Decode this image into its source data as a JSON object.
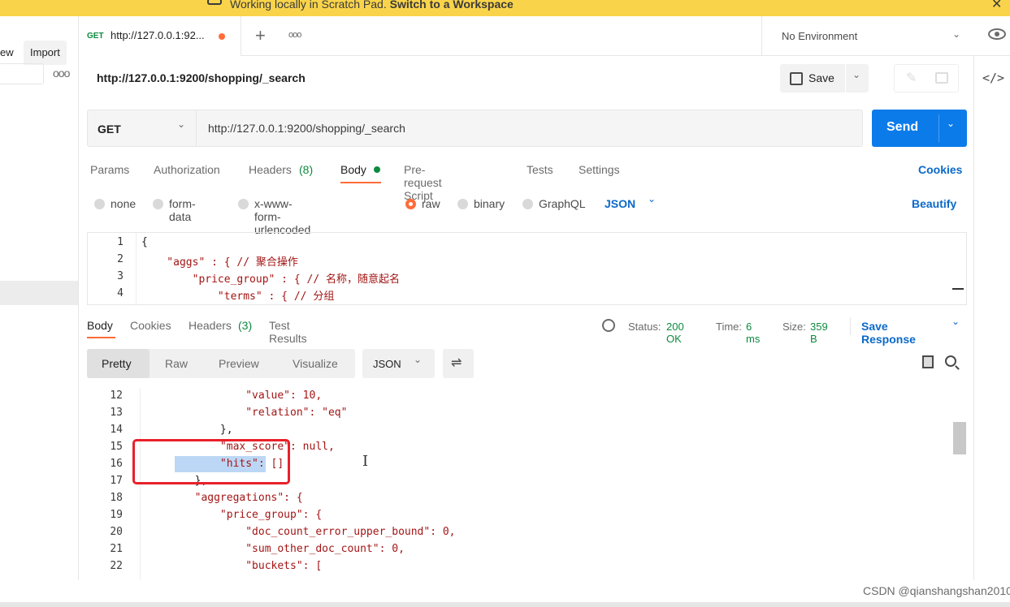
{
  "banner": {
    "prefix": "Working locally in Scratch Pad.",
    "link": "Switch to a Workspace"
  },
  "sidebar": {
    "new_label": "ew",
    "import_label": "Import"
  },
  "tab": {
    "method": "GET",
    "title": "http://127.0.0.1:92..."
  },
  "environment": {
    "label": "No Environment"
  },
  "request": {
    "title": "http://127.0.0.1:9200/shopping/_search",
    "method": "GET",
    "url": "http://127.0.0.1:9200/shopping/_search",
    "save_label": "Save",
    "send_label": "Send"
  },
  "req_tabs": {
    "params": "Params",
    "authorization": "Authorization",
    "headers": "Headers",
    "headers_count": "(8)",
    "body": "Body",
    "prerequest": "Pre-request Script",
    "tests": "Tests",
    "settings": "Settings",
    "cookies": "Cookies"
  },
  "body_types": {
    "none": "none",
    "form_data": "form-data",
    "urlencoded": "x-www-form-urlencoded",
    "raw": "raw",
    "binary": "binary",
    "graphql": "GraphQL",
    "json": "JSON",
    "beautify": "Beautify"
  },
  "editor_lines": [
    {
      "num": "1",
      "text": "{"
    },
    {
      "num": "2",
      "text": "    \"aggs\" : { // 聚合操作"
    },
    {
      "num": "3",
      "text": "        \"price_group\" : { // 名称，随意起名"
    },
    {
      "num": "4",
      "text": "            \"terms\" : { // 分组"
    }
  ],
  "resp_tabs": {
    "body": "Body",
    "cookies": "Cookies",
    "headers": "Headers",
    "headers_count": "(3)",
    "test_results": "Test Results"
  },
  "status": {
    "status_label": "Status:",
    "status_value": "200 OK",
    "time_label": "Time:",
    "time_value": "6 ms",
    "size_label": "Size:",
    "size_value": "359 B",
    "save_response": "Save Response"
  },
  "view_tabs": {
    "pretty": "Pretty",
    "raw": "Raw",
    "preview": "Preview",
    "visualize": "Visualize",
    "format": "JSON"
  },
  "response_lines": [
    {
      "num": "12",
      "text": "                \"value\": 10,"
    },
    {
      "num": "13",
      "text": "                \"relation\": \"eq\""
    },
    {
      "num": "14",
      "text": "            },"
    },
    {
      "num": "15",
      "text": "            \"max_score\": null,"
    },
    {
      "num": "16",
      "text": "            \"hits\": []"
    },
    {
      "num": "17",
      "text": "        },"
    },
    {
      "num": "18",
      "text": "        \"aggregations\": {"
    },
    {
      "num": "19",
      "text": "            \"price_group\": {"
    },
    {
      "num": "20",
      "text": "                \"doc_count_error_upper_bound\": 0,"
    },
    {
      "num": "21",
      "text": "                \"sum_other_doc_count\": 0,"
    },
    {
      "num": "22",
      "text": "                \"buckets\": ["
    }
  ],
  "watermark": "CSDN @qianshangshan2010",
  "colors": {
    "banner": "#f9d44b",
    "send": "#0b7bea",
    "accent": "#ff6c37",
    "link": "#0b69c8",
    "status_ok": "#0d8a3f",
    "highlight_box": "#e8202a"
  }
}
